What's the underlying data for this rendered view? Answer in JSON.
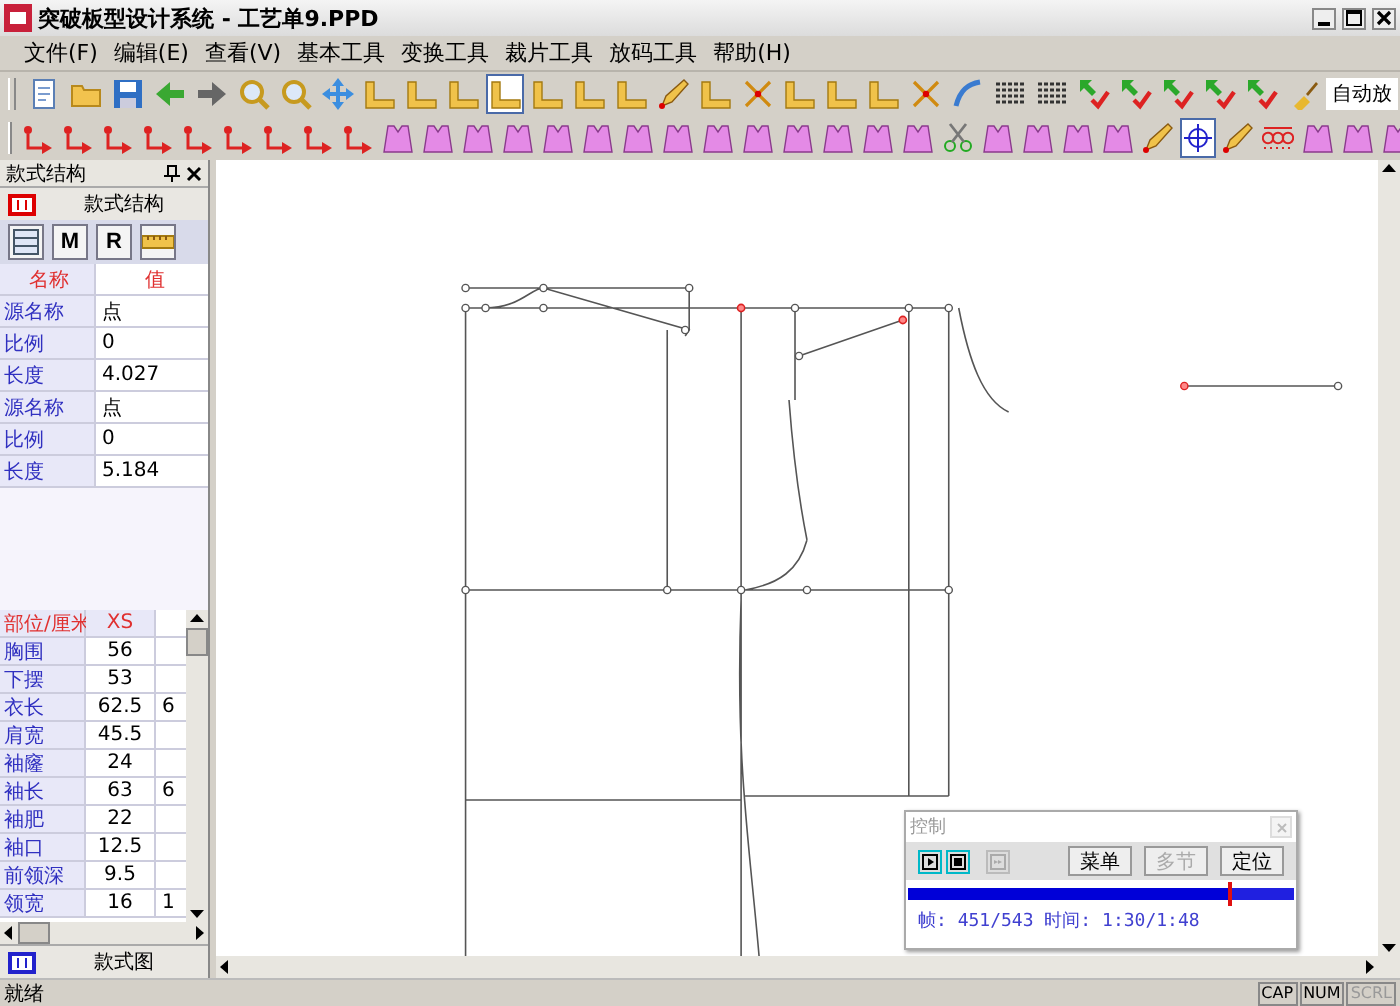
{
  "window": {
    "title": "突破板型设计系统 - 工艺单9.PPD"
  },
  "menu": [
    "文件(F)",
    "编辑(E)",
    "查看(V)",
    "基本工具",
    "变换工具",
    "裁片工具",
    "放码工具",
    "帮助(H)"
  ],
  "toolbars": [
    {
      "tools": [
        {
          "selected": false
        },
        {
          "selected": false
        },
        {
          "selected": false
        },
        {
          "selected": false
        },
        {
          "selected": false
        },
        {
          "selected": false
        },
        {
          "selected": false
        },
        {
          "selected": false
        },
        {
          "selected": false
        },
        {
          "selected": false
        },
        {
          "selected": false
        },
        {
          "selected": true
        },
        {
          "selected": false
        },
        {
          "selected": false
        },
        {
          "selected": false
        },
        {
          "selected": false
        },
        {
          "selected": false
        },
        {
          "selected": false
        },
        {
          "selected": false
        },
        {
          "selected": false
        },
        {
          "selected": false
        },
        {
          "selected": false
        },
        {
          "selected": false
        },
        {
          "selected": false
        },
        {
          "selected": false
        },
        {
          "selected": false
        },
        {
          "selected": false
        },
        {
          "selected": false
        },
        {
          "selected": false
        },
        {
          "selected": false
        },
        {
          "selected": false
        }
      ],
      "text_button": "自动放"
    },
    {
      "tools": [
        {
          "selected": false
        },
        {
          "selected": false
        },
        {
          "selected": false
        },
        {
          "selected": false
        },
        {
          "selected": false
        },
        {
          "selected": false
        },
        {
          "selected": false
        },
        {
          "selected": false
        },
        {
          "selected": false
        },
        {
          "selected": false
        },
        {
          "selected": false
        },
        {
          "selected": false
        },
        {
          "selected": false
        },
        {
          "selected": false
        },
        {
          "selected": false
        },
        {
          "selected": false
        },
        {
          "selected": false
        },
        {
          "selected": false
        },
        {
          "selected": false
        },
        {
          "selected": false
        },
        {
          "selected": false
        },
        {
          "selected": false
        },
        {
          "selected": false
        },
        {
          "selected": false
        },
        {
          "selected": false
        },
        {
          "selected": false
        },
        {
          "selected": false
        },
        {
          "selected": false
        },
        {
          "selected": false
        },
        {
          "selected": true
        },
        {
          "selected": false
        },
        {
          "selected": false
        },
        {
          "selected": false
        },
        {
          "selected": false
        },
        {
          "selected": false
        }
      ]
    }
  ],
  "left_panel": {
    "title": "款式结构",
    "tab": "款式结构",
    "tool_buttons": [
      "M",
      "R"
    ],
    "properties": {
      "columns": [
        "名称",
        "值"
      ],
      "rows": [
        {
          "name": "源名称",
          "value": "点"
        },
        {
          "name": "比例",
          "value": "0"
        },
        {
          "name": "长度",
          "value": "4.027"
        },
        {
          "name": "源名称",
          "value": "点"
        },
        {
          "name": "比例",
          "value": "0"
        },
        {
          "name": "长度",
          "value": "5.184"
        }
      ]
    },
    "measurements": {
      "columns": [
        "部位/厘米",
        "XS"
      ],
      "rows": [
        {
          "part": "胸围",
          "xs": "56"
        },
        {
          "part": "下摆",
          "xs": "53"
        },
        {
          "part": "衣长",
          "xs": "62.5",
          "column_3": "6"
        },
        {
          "part": "肩宽",
          "xs": "45.5"
        },
        {
          "part": "袖窿",
          "xs": "24"
        },
        {
          "part": "袖长",
          "xs": "63",
          "column_3": "6"
        },
        {
          "part": "袖肥",
          "xs": "22"
        },
        {
          "part": "袖口",
          "xs": "12.5"
        },
        {
          "part": "前领深",
          "xs": "9.5"
        },
        {
          "part": "领宽",
          "xs": "16",
          "column_3": "1"
        }
      ]
    },
    "bottom_tab": "款式图"
  },
  "control_panel": {
    "title": "控制",
    "buttons": [
      {
        "label": "菜单",
        "disabled": false
      },
      {
        "label": "多节",
        "disabled": true
      },
      {
        "label": "定位",
        "disabled": false
      }
    ],
    "progress": {
      "level": 0.83
    },
    "info": "帧: 451/543 时间: 1:30/1:48"
  },
  "status_bar": {
    "text": "就绪",
    "indicators": [
      {
        "label": "CAP",
        "disabled": false
      },
      {
        "label": "NUM",
        "disabled": false
      },
      {
        "label": "SCRL",
        "disabled": true
      }
    ]
  }
}
